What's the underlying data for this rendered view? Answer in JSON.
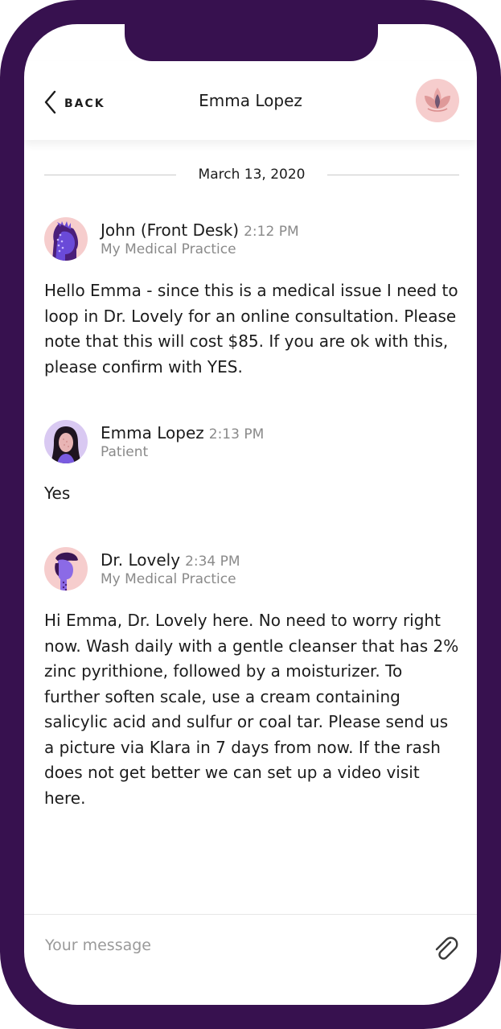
{
  "header": {
    "back_label": "BACK",
    "title": "Emma Lopez",
    "logo_icon": "lotus-logo-icon"
  },
  "status_bar": {
    "icons": [
      "signal-icon",
      "wifi-icon",
      "battery-icon"
    ]
  },
  "date_divider": "March 13, 2020",
  "messages": [
    {
      "name": "John (Front Desk)",
      "time": "2:12 PM",
      "subtitle": "My Medical Practice",
      "text": "Hello Emma - since this is a medical issue I need to loop in Dr. Lovely for an online consultation. Please note that this will cost $85. If you are ok with this, please confirm with YES."
    },
    {
      "name": "Emma Lopez",
      "time": "2:13 PM",
      "subtitle": "Patient",
      "text": "Yes"
    },
    {
      "name": "Dr. Lovely",
      "time": "2:34 PM",
      "subtitle": "My Medical Practice",
      "text": "Hi Emma, Dr. Lovely here. No need to worry right now. Wash daily with a gentle cleanser that has 2% zinc pyrithione, followed by a moisturizer. To further soften scale, use a cream containing salicylic acid and sulfur or coal tar. Please send us a picture via Klara in 7 days from now. If the rash does not get better we can set up a video visit here."
    }
  ],
  "composer": {
    "placeholder": "Your message",
    "attach_icon": "paperclip-icon"
  },
  "colors": {
    "frame": "#37114f",
    "avatar_pink": "#f6cdcd",
    "avatar_lavender": "#d9c9f2",
    "accent_purple": "#6a4ad8"
  }
}
